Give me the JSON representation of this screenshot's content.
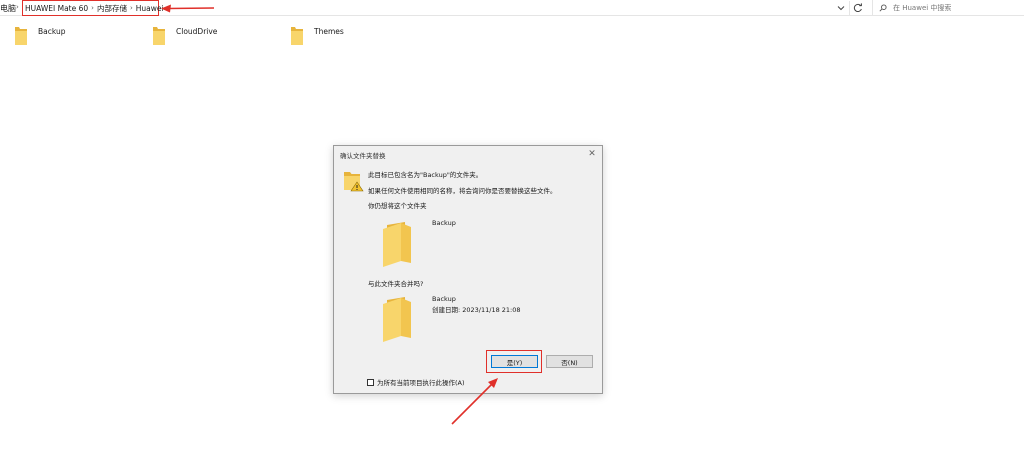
{
  "address_bar": {
    "root_label": "电脑",
    "breadcrumbs": [
      "HUAWEI Mate 60",
      "内部存储",
      "Huawei"
    ],
    "search_placeholder": "在 Huawei 中搜索"
  },
  "folders": [
    {
      "name": "Backup"
    },
    {
      "name": "CloudDrive"
    },
    {
      "name": "Themes"
    }
  ],
  "dialog": {
    "title": "确认文件夹替换",
    "line1": "此目标已包含名为\"Backup\"的文件夹。",
    "line2": "如果任何文件使用相同的名称，将会询问你是否要替换这些文件。",
    "line3": "你仍想将这个文件夹",
    "existing_folder_name": "Backup",
    "merge_question": "与此文件夹合并吗?",
    "source_folder_name": "Backup",
    "source_created": "创建日期: 2023/11/18 21:08",
    "yes_label": "是(Y)",
    "no_label": "否(N)",
    "apply_all_label": "为所有当前项目执行此操作(A)",
    "apply_all_checked": false
  },
  "colors": {
    "highlight_red": "#e0302a",
    "folder_yellow": "#f5c84c",
    "folder_light": "#fbe08a",
    "dialog_bg": "#f0f0f0",
    "focus_blue": "#0078d7"
  },
  "icons": {
    "folder": "folder-icon",
    "warning": "warning-icon",
    "close": "close-icon",
    "refresh": "refresh-icon",
    "search": "search-icon",
    "chevron": "chevron-down-icon"
  }
}
